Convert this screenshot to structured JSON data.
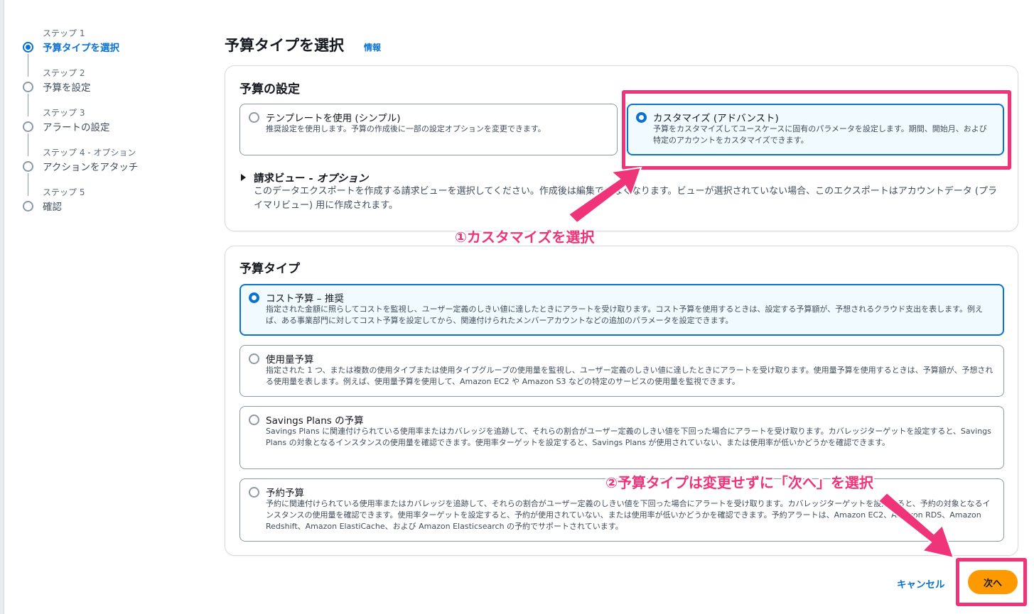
{
  "stepper": {
    "steps": [
      {
        "small": "ステップ 1",
        "label": "予算タイプを選択"
      },
      {
        "small": "ステップ 2",
        "label": "予算を設定"
      },
      {
        "small": "ステップ 3",
        "label": "アラートの設定"
      },
      {
        "small": "ステップ 4 - オプション",
        "label": "アクションをアタッチ"
      },
      {
        "small": "ステップ 5",
        "label": "確認"
      }
    ]
  },
  "header": {
    "title": "予算タイプを選択",
    "info": "情報"
  },
  "budget_settings": {
    "title": "予算の設定",
    "template": {
      "title": "テンプレートを使用 (シンプル)",
      "desc": "推奨設定を使用します。予算の作成後に一部の設定オプションを変更できます。"
    },
    "custom": {
      "title": "カスタマイズ (アドバンスト)",
      "desc": "予算をカスタマイズしてユースケースに固有のパラメータを設定します。期間、開始月、および特定のアカウントをカスタマイズできます。"
    },
    "billing_view": {
      "title": "請求ビュー - ",
      "title_em": "オプション",
      "desc": "このデータエクスポートを作成する請求ビューを選択してください。作成後は編集できなくなります。ビューが選択されていない場合、このエクスポートはアカウントデータ (プライマリビュー) 用に作成されます。"
    }
  },
  "budget_types": {
    "title": "予算タイプ",
    "options": [
      {
        "title": "コスト予算 – 推奨",
        "desc": "指定された金額に照らしてコストを監視し、ユーザー定義のしきい値に達したときにアラートを受け取ります。コスト予算を使用するときは、設定する予算額が、予想されるクラウド支出を表します。例えば、ある事業部門に対してコスト予算を設定してから、関連付けられたメンバーアカウントなどの追加のパラメータを設定できます。"
      },
      {
        "title": "使用量予算",
        "desc": "指定された 1 つ、または複数の使用タイプまたは使用タイプグループの使用量を監視し、ユーザー定義のしきい値に達したときにアラートを受け取ります。使用量予算を使用するときは、予算額が、予想される使用量を表します。例えば、使用量予算を使用して、Amazon EC2 や Amazon S3 などの特定のサービスの使用量を監視できます。"
      },
      {
        "title": "Savings Plans の予算",
        "desc": "Savings Plans に関連付けられている使用率またはカバレッジを追跡して、それらの割合がユーザー定義のしきい値を下回った場合にアラートを受け取ります。カバレッジターゲットを設定すると、Savings Plans の対象となるインスタンスの使用量を確認できます。使用率ターゲットを設定すると、Savings Plans が使用されていない、または使用率が低いかどうかを確認できます。"
      },
      {
        "title": "予約予算",
        "desc": "予約に関連付けられている使用率またはカバレッジを追跡して、それらの割合がユーザー定義のしきい値を下回った場合にアラートを受け取ります。カバレッジターゲットを設定すると、予約の対象となるインスタンスの使用量を確認できます。使用率ターゲットを設定すると、予約が使用されていない、または使用率が低いかどうかを確認できます。予約アラートは、Amazon EC2、Amazon RDS、Amazon Redshift、Amazon ElastiCache、および Amazon Elasticsearch の予約でサポートされています。"
      }
    ]
  },
  "annotations": {
    "step1": "①カスタマイズを選択",
    "step2": "②予算タイプは変更せずに「次へ」を選択",
    "color": "#f0347a"
  },
  "footer": {
    "cancel": "キャンセル",
    "next": "次へ"
  },
  "colors": {
    "accent": "#0972d3",
    "primary_button": "#ff9900"
  }
}
